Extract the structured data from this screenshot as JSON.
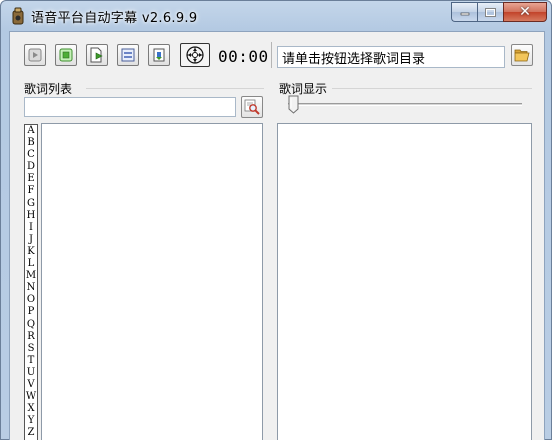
{
  "window": {
    "title": "语音平台自动字幕 v2.6.9.9"
  },
  "toolbar": {
    "buttons": [
      {
        "icon": "play-icon"
      },
      {
        "icon": "stop-icon"
      },
      {
        "icon": "export-icon"
      },
      {
        "icon": "edit-icon"
      },
      {
        "icon": "import-icon"
      },
      {
        "icon": "move-icon"
      }
    ],
    "timer": "00:00",
    "directory_value": "请单击按钮选择歌词目录"
  },
  "lyrics_list": {
    "label": "歌词列表",
    "search_value": "",
    "index_letters": [
      "A",
      "B",
      "C",
      "D",
      "E",
      "F",
      "G",
      "H",
      "I",
      "J",
      "K",
      "L",
      "M",
      "N",
      "O",
      "P",
      "Q",
      "R",
      "S",
      "T",
      "U",
      "V",
      "W",
      "X",
      "Y",
      "Z"
    ]
  },
  "lyrics_display": {
    "label": "歌词显示",
    "slider_value": 0
  },
  "colors": {
    "titlebar": "#b9cde4",
    "client_bg": "#f0f0f0",
    "close_button": "#c2432a"
  }
}
